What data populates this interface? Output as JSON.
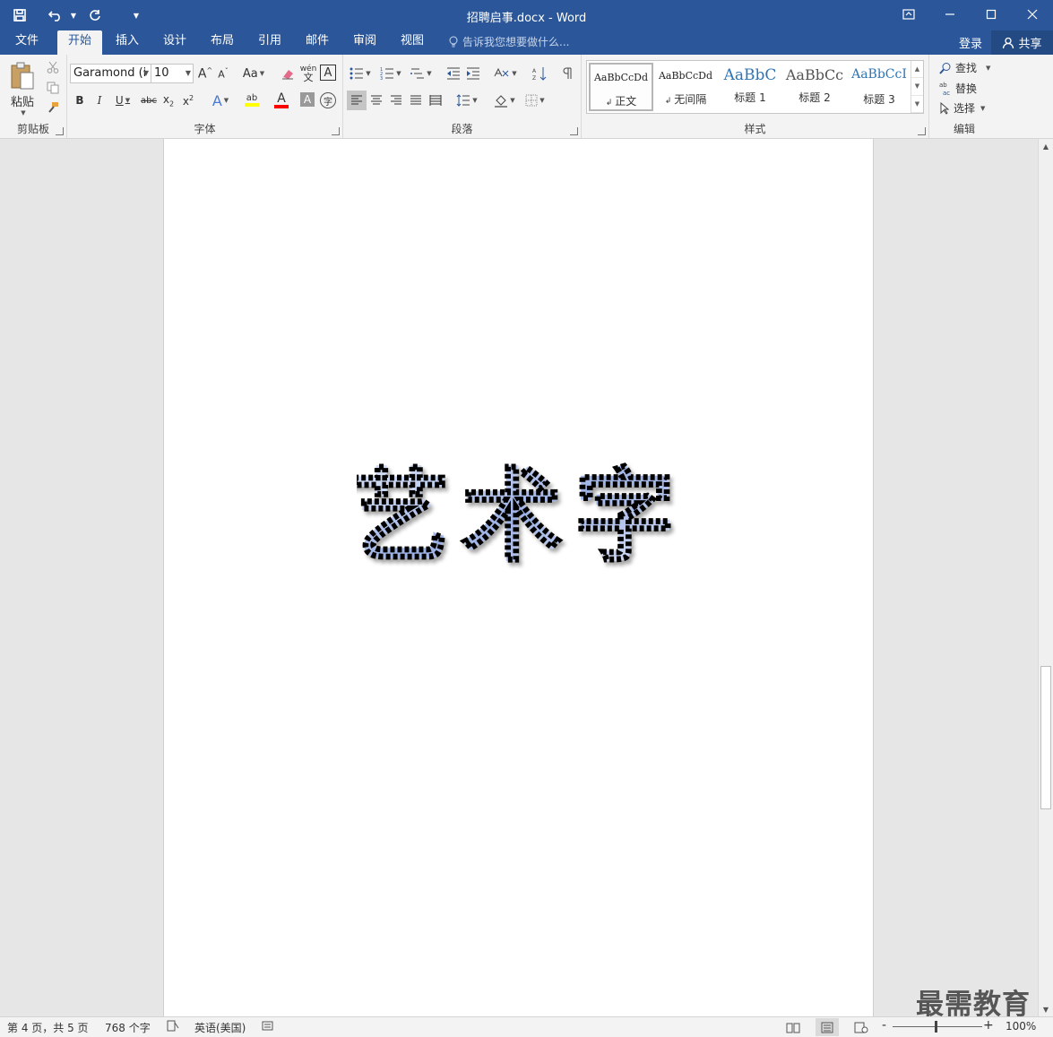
{
  "window": {
    "title": "招聘启事.docx - Word"
  },
  "tabs": [
    {
      "label": "文件",
      "active": false
    },
    {
      "label": "开始",
      "active": true
    },
    {
      "label": "插入",
      "active": false
    },
    {
      "label": "设计",
      "active": false
    },
    {
      "label": "布局",
      "active": false
    },
    {
      "label": "引用",
      "active": false
    },
    {
      "label": "邮件",
      "active": false
    },
    {
      "label": "审阅",
      "active": false
    },
    {
      "label": "视图",
      "active": false
    }
  ],
  "tell_me": "告诉我您想要做什么...",
  "account": {
    "login": "登录",
    "share": "共享"
  },
  "clipboard": {
    "paste_label": "粘贴",
    "group_label": "剪贴板"
  },
  "font": {
    "name": "Garamond (i",
    "size": "10",
    "group_label": "字体",
    "change_case": "Aa",
    "phonetic_label": "wén"
  },
  "paragraph": {
    "group_label": "段落"
  },
  "styles": {
    "group_label": "样式",
    "items": [
      {
        "sample": "AaBbCcDd",
        "name": "正文",
        "selected": true
      },
      {
        "sample": "AaBbCcDd",
        "name": "无间隔",
        "selected": false
      },
      {
        "sample": "AaBbC",
        "name": "标题 1",
        "selected": false
      },
      {
        "sample": "AaBbCc",
        "name": "标题 2",
        "selected": false
      },
      {
        "sample": "AaBbCcI",
        "name": "标题 3",
        "selected": false
      }
    ]
  },
  "editing": {
    "find": "查找",
    "replace": "替换",
    "select": "选择",
    "group_label": "编辑"
  },
  "document": {
    "wordart_text": "艺术字"
  },
  "status": {
    "page": "第 4 页，共 5 页",
    "words": "768 个字",
    "language": "英语(美国)",
    "zoom": "100%",
    "zoom_minus": "-",
    "zoom_plus": "+"
  },
  "watermark": "最需教育",
  "colors": {
    "accent": "#2b579a",
    "highlight": "#ffff00",
    "font_color": "#ff0000"
  }
}
